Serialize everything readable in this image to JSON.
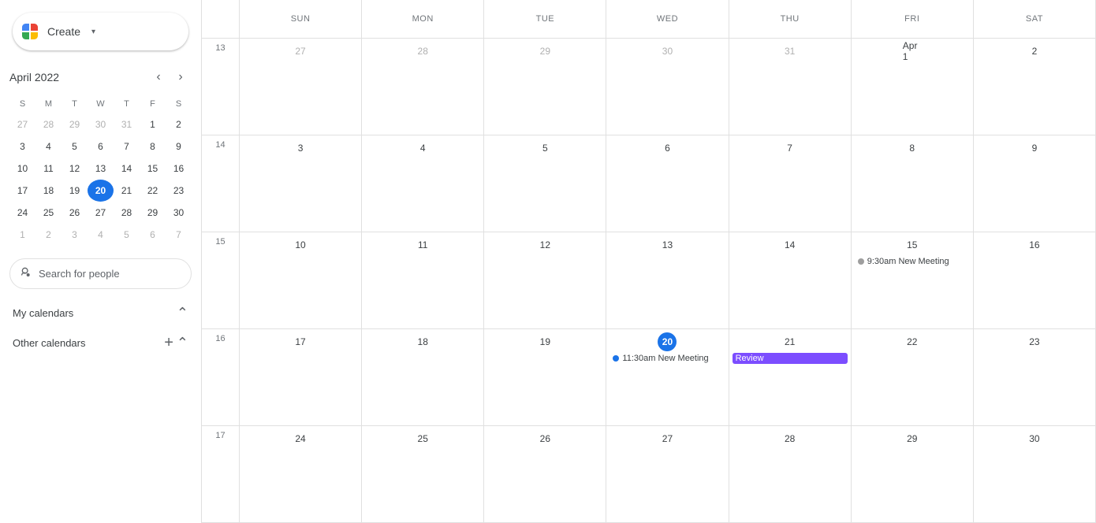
{
  "sidebar": {
    "create_label": "Create",
    "mini_calendar": {
      "title": "April 2022",
      "day_headers": [
        "S",
        "M",
        "T",
        "W",
        "T",
        "F",
        "S"
      ],
      "weeks": [
        [
          {
            "date": "27",
            "other": true
          },
          {
            "date": "28",
            "other": true
          },
          {
            "date": "29",
            "other": true
          },
          {
            "date": "30",
            "other": true
          },
          {
            "date": "31",
            "other": true
          },
          {
            "date": "1",
            "other": false
          },
          {
            "date": "2",
            "other": false
          }
        ],
        [
          {
            "date": "3",
            "other": false
          },
          {
            "date": "4",
            "other": false
          },
          {
            "date": "5",
            "other": false
          },
          {
            "date": "6",
            "other": false
          },
          {
            "date": "7",
            "other": false
          },
          {
            "date": "8",
            "other": false
          },
          {
            "date": "9",
            "other": false
          }
        ],
        [
          {
            "date": "10",
            "other": false
          },
          {
            "date": "11",
            "other": false
          },
          {
            "date": "12",
            "other": false
          },
          {
            "date": "13",
            "other": false
          },
          {
            "date": "14",
            "other": false
          },
          {
            "date": "15",
            "other": false
          },
          {
            "date": "16",
            "other": false
          }
        ],
        [
          {
            "date": "17",
            "other": false
          },
          {
            "date": "18",
            "other": false
          },
          {
            "date": "19",
            "other": false
          },
          {
            "date": "20",
            "other": false,
            "today": true
          },
          {
            "date": "21",
            "other": false
          },
          {
            "date": "22",
            "other": false
          },
          {
            "date": "23",
            "other": false
          }
        ],
        [
          {
            "date": "24",
            "other": false
          },
          {
            "date": "25",
            "other": false
          },
          {
            "date": "26",
            "other": false
          },
          {
            "date": "27",
            "other": false
          },
          {
            "date": "28",
            "other": false
          },
          {
            "date": "29",
            "other": false
          },
          {
            "date": "30",
            "other": false
          }
        ],
        [
          {
            "date": "1",
            "other": true
          },
          {
            "date": "2",
            "other": true
          },
          {
            "date": "3",
            "other": true
          },
          {
            "date": "4",
            "other": true
          },
          {
            "date": "5",
            "other": true
          },
          {
            "date": "6",
            "other": true
          },
          {
            "date": "7",
            "other": true
          }
        ]
      ]
    },
    "search_people_placeholder": "Search for people",
    "my_calendars_label": "My calendars",
    "other_calendars_label": "Other calendars"
  },
  "calendar": {
    "day_headers": [
      {
        "abbr": "SUN"
      },
      {
        "abbr": "MON"
      },
      {
        "abbr": "TUE"
      },
      {
        "abbr": "WED"
      },
      {
        "abbr": "THU"
      },
      {
        "abbr": "FRI"
      },
      {
        "abbr": "SAT"
      }
    ],
    "weeks": [
      {
        "week_num": "13",
        "days": [
          {
            "date": "27",
            "other": true,
            "events": []
          },
          {
            "date": "28",
            "other": true,
            "events": []
          },
          {
            "date": "29",
            "other": true,
            "events": []
          },
          {
            "date": "30",
            "other": true,
            "events": []
          },
          {
            "date": "31",
            "other": true,
            "events": []
          },
          {
            "date": "Apr 1",
            "other": false,
            "events": []
          },
          {
            "date": "2",
            "other": false,
            "events": []
          }
        ]
      },
      {
        "week_num": "14",
        "days": [
          {
            "date": "3",
            "other": false,
            "events": []
          },
          {
            "date": "4",
            "other": false,
            "events": []
          },
          {
            "date": "5",
            "other": false,
            "events": []
          },
          {
            "date": "6",
            "other": false,
            "events": []
          },
          {
            "date": "7",
            "other": false,
            "events": []
          },
          {
            "date": "8",
            "other": false,
            "events": []
          },
          {
            "date": "9",
            "other": false,
            "events": []
          }
        ]
      },
      {
        "week_num": "15",
        "days": [
          {
            "date": "10",
            "other": false,
            "events": []
          },
          {
            "date": "11",
            "other": false,
            "events": []
          },
          {
            "date": "12",
            "other": false,
            "events": []
          },
          {
            "date": "13",
            "other": false,
            "events": []
          },
          {
            "date": "14",
            "other": false,
            "events": []
          },
          {
            "date": "15",
            "other": false,
            "events": [
              {
                "type": "gray-dot",
                "label": "9:30am New Meeting"
              }
            ]
          },
          {
            "date": "16",
            "other": false,
            "events": []
          }
        ]
      },
      {
        "week_num": "16",
        "days": [
          {
            "date": "17",
            "other": false,
            "events": []
          },
          {
            "date": "18",
            "other": false,
            "events": []
          },
          {
            "date": "19",
            "other": false,
            "events": []
          },
          {
            "date": "20",
            "other": false,
            "today": true,
            "events": [
              {
                "type": "blue-dot",
                "label": "11:30am New Meeting"
              }
            ]
          },
          {
            "date": "21",
            "other": false,
            "events": [
              {
                "type": "purple",
                "label": "Review"
              }
            ]
          },
          {
            "date": "22",
            "other": false,
            "events": []
          },
          {
            "date": "23",
            "other": false,
            "events": []
          }
        ]
      },
      {
        "week_num": "17",
        "days": [
          {
            "date": "24",
            "other": false,
            "events": []
          },
          {
            "date": "25",
            "other": false,
            "events": []
          },
          {
            "date": "26",
            "other": false,
            "events": []
          },
          {
            "date": "27",
            "other": false,
            "events": []
          },
          {
            "date": "28",
            "other": false,
            "events": []
          },
          {
            "date": "29",
            "other": false,
            "events": []
          },
          {
            "date": "30",
            "other": false,
            "events": []
          }
        ]
      }
    ]
  }
}
